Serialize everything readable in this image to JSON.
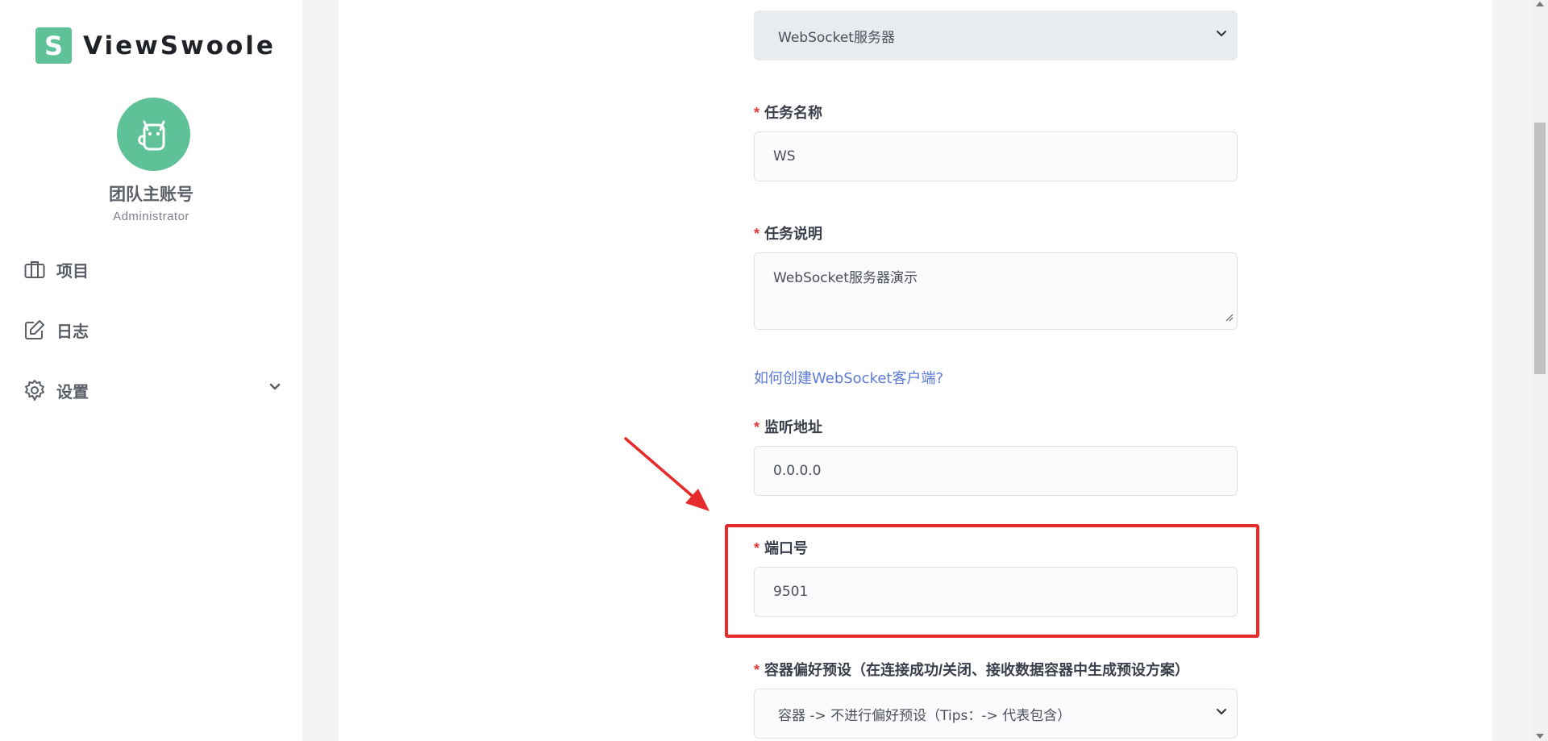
{
  "brand": {
    "icon_letter": "S",
    "name": "ViewSwoole",
    "color": "#5fc198"
  },
  "user": {
    "avatar_icon": "cat-icon",
    "name": "团队主账号",
    "role": "Administrator"
  },
  "sidebar": {
    "items": [
      {
        "label": "项目",
        "icon": "briefcase-icon"
      },
      {
        "label": "日志",
        "icon": "edit-icon"
      },
      {
        "label": "设置",
        "icon": "gear-icon",
        "expandable": true
      }
    ]
  },
  "form": {
    "server_type": {
      "value": "WebSocket服务器"
    },
    "task_name": {
      "label": "任务名称",
      "required": "*",
      "value": "WS"
    },
    "task_desc": {
      "label": "任务说明",
      "required": "*",
      "value": "WebSocket服务器演示"
    },
    "help_link": "如何创建WebSocket客户端?",
    "listen_addr": {
      "label": "监听地址",
      "required": "*",
      "value": "0.0.0.0"
    },
    "port": {
      "label": "端口号",
      "required": "*",
      "value": "9501"
    },
    "container_pref": {
      "label": "容器偏好预设（在连接成功/关闭、接收数据容器中生成预设方案）",
      "required": "*",
      "value": "容器 -> 不进行偏好预设（Tips：-> 代表包含）"
    }
  },
  "annotation": {
    "highlight_color": "#e52b2b"
  }
}
